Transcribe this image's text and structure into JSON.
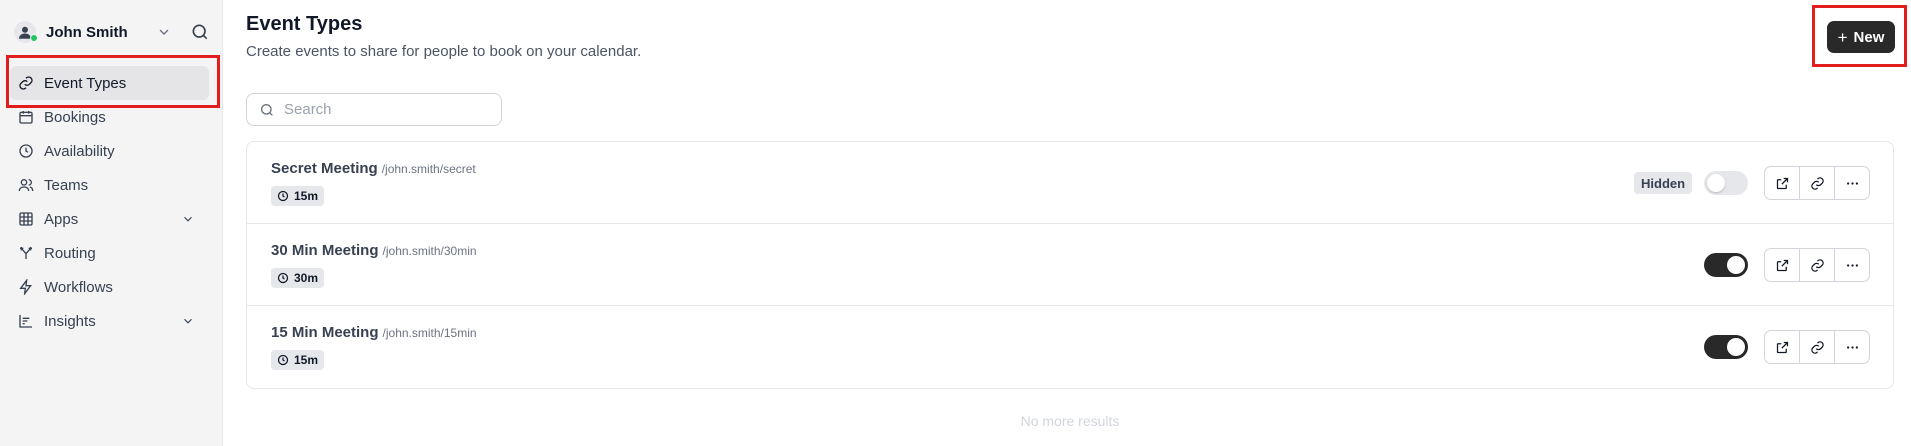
{
  "user": {
    "name": "John Smith"
  },
  "sidebar": {
    "items": [
      {
        "label": "Event Types",
        "icon": "link-icon",
        "active": true
      },
      {
        "label": "Bookings",
        "icon": "calendar-icon"
      },
      {
        "label": "Availability",
        "icon": "clock-icon"
      },
      {
        "label": "Teams",
        "icon": "users-icon"
      },
      {
        "label": "Apps",
        "icon": "grid-icon",
        "expandable": true
      },
      {
        "label": "Routing",
        "icon": "split-icon"
      },
      {
        "label": "Workflows",
        "icon": "zap-icon"
      },
      {
        "label": "Insights",
        "icon": "chart-icon",
        "expandable": true
      }
    ]
  },
  "header": {
    "title": "Event Types",
    "subtitle": "Create events to share for people to book on your calendar.",
    "new_label": "New",
    "new_icon": "plus-icon"
  },
  "search": {
    "placeholder": "Search",
    "value": ""
  },
  "events": [
    {
      "title": "Secret Meeting",
      "slug": "/john.smith/secret",
      "duration": "15m",
      "hidden_label": "Hidden",
      "enabled": false
    },
    {
      "title": "30 Min Meeting",
      "slug": "/john.smith/30min",
      "duration": "30m",
      "enabled": true
    },
    {
      "title": "15 Min Meeting",
      "slug": "/john.smith/15min",
      "duration": "15m",
      "enabled": true
    }
  ],
  "footer": {
    "no_more": "No more results"
  },
  "colors": {
    "annotation": "#e11d1d",
    "primary_button": "#292929",
    "status_online": "#22c55e"
  }
}
